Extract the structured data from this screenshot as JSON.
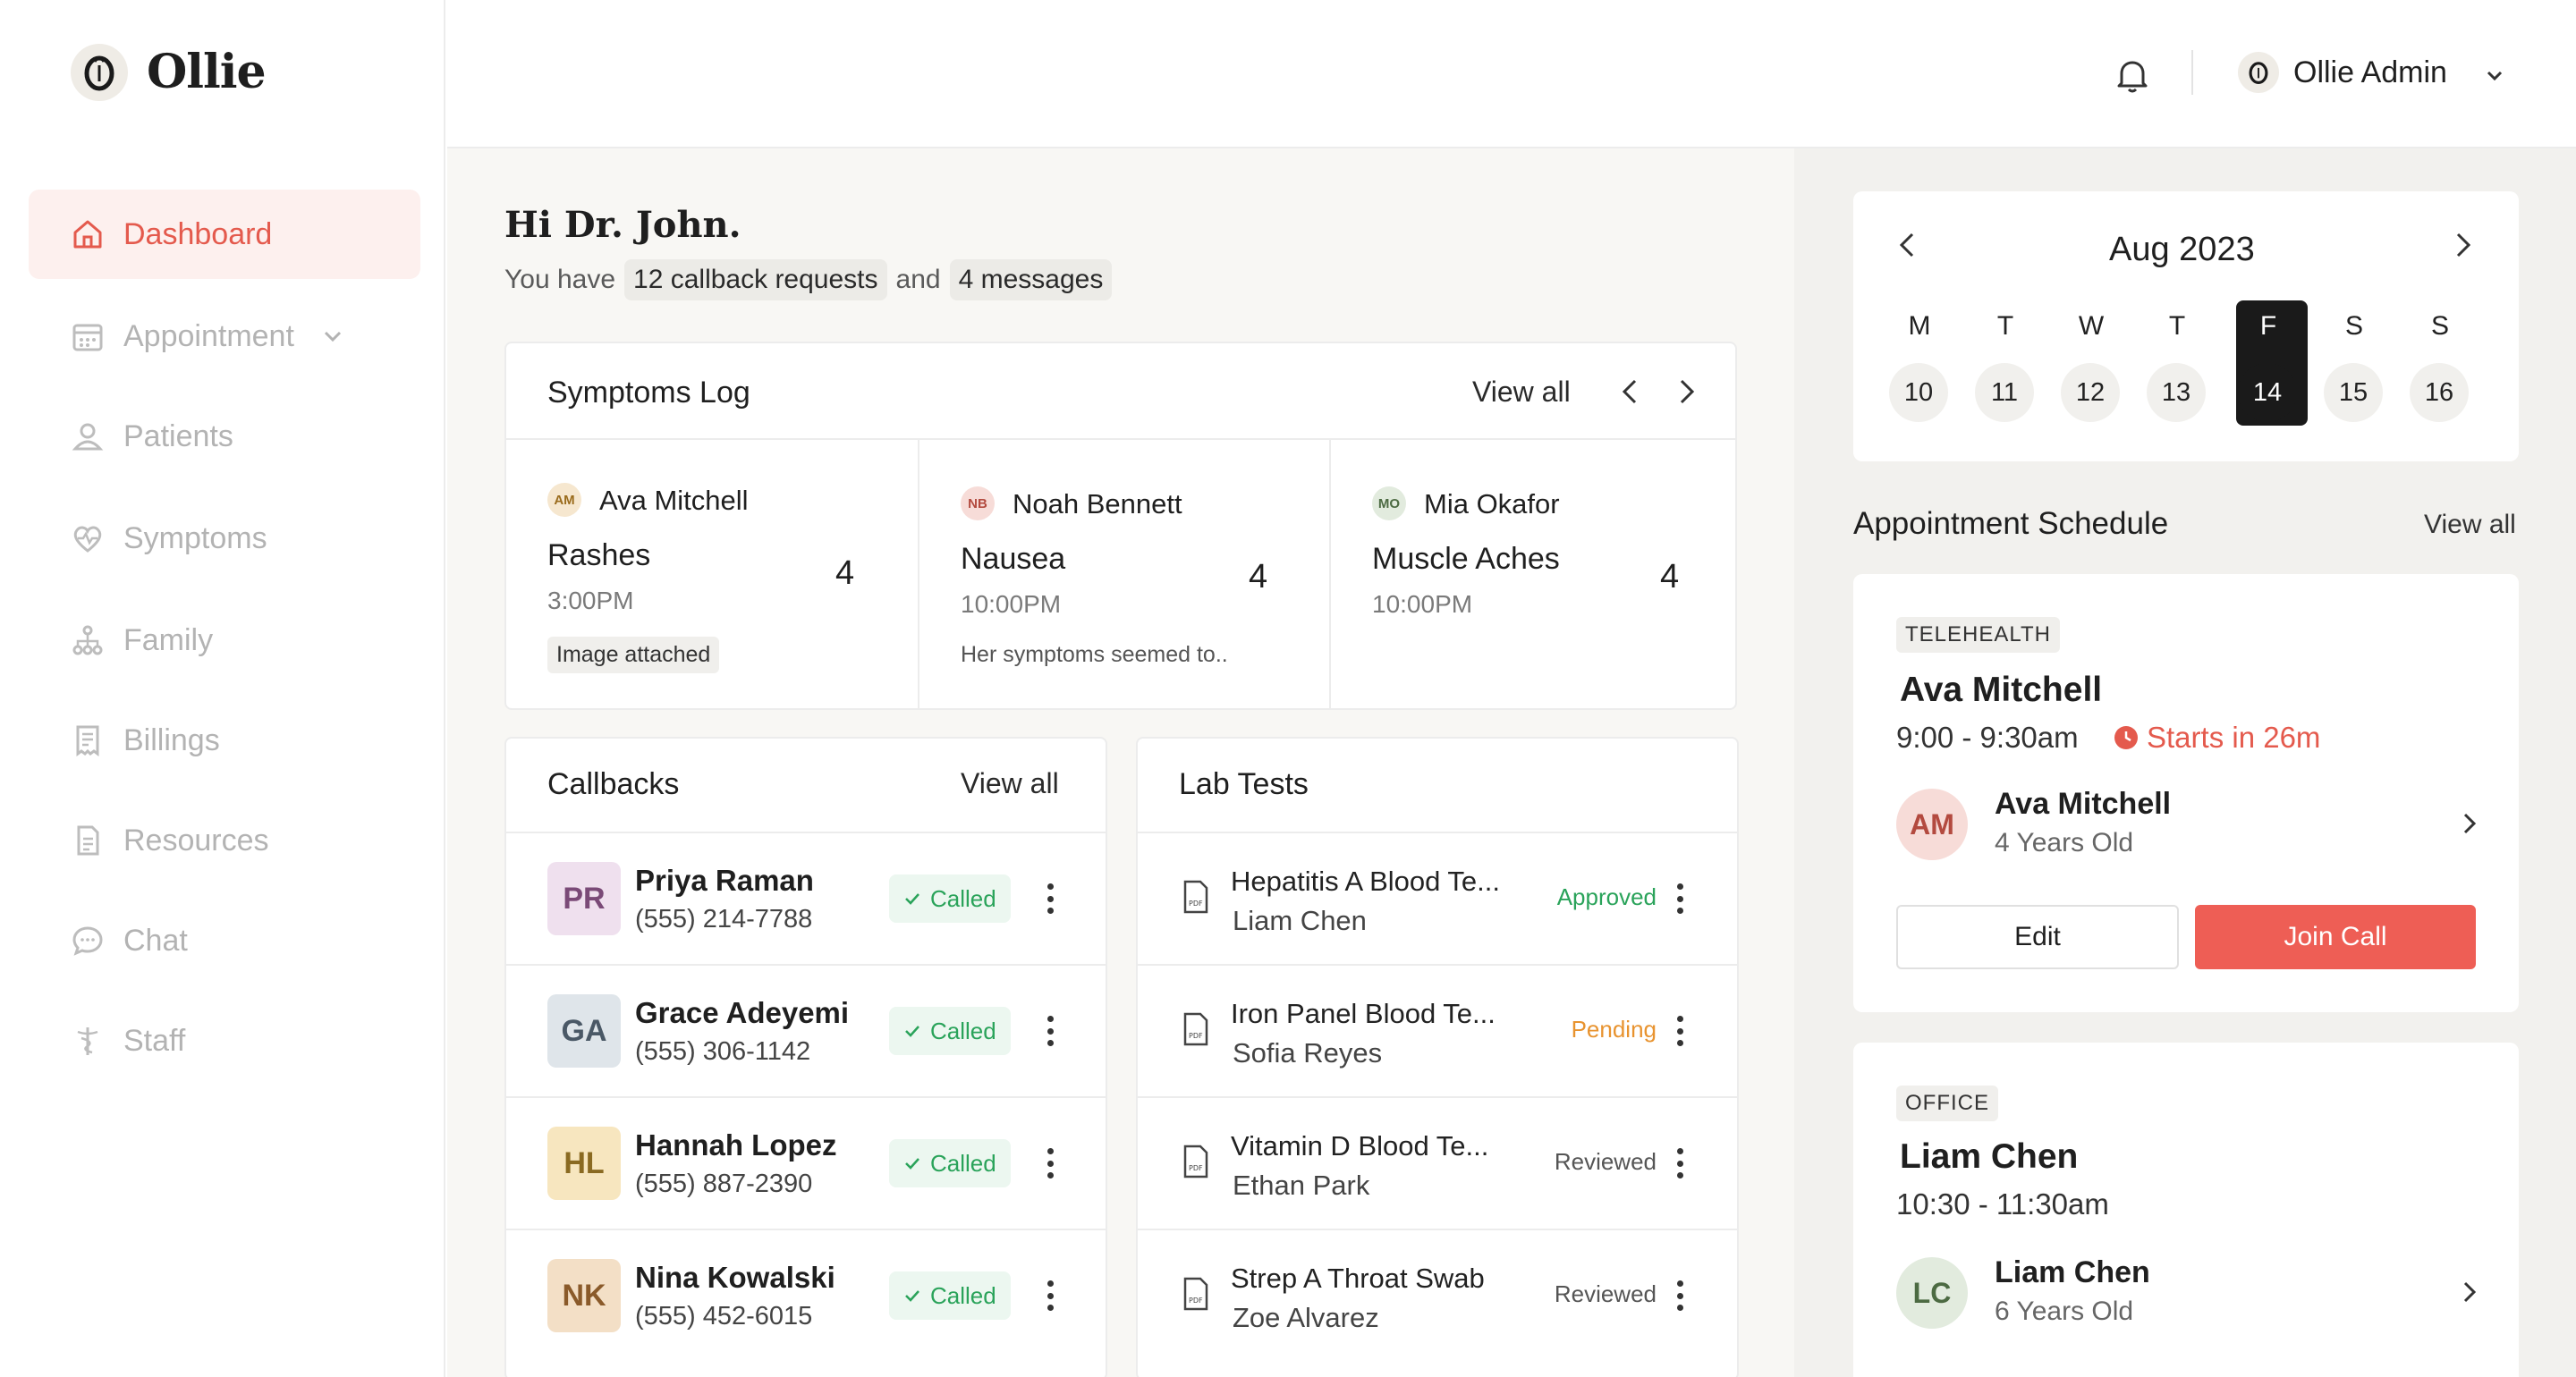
{
  "app": {
    "name": "Ollie"
  },
  "sidebar": {
    "items": [
      {
        "label": "Dashboard",
        "icon": "home-icon",
        "active": true
      },
      {
        "label": "Appointment",
        "icon": "calendar-icon",
        "expandable": true
      },
      {
        "label": "Patients",
        "icon": "patient-icon"
      },
      {
        "label": "Symptoms",
        "icon": "heart-pulse-icon"
      },
      {
        "label": "Family",
        "icon": "family-tree-icon"
      },
      {
        "label": "Billings",
        "icon": "receipt-icon"
      },
      {
        "label": "Resources",
        "icon": "document-icon"
      },
      {
        "label": "Chat",
        "icon": "chat-icon"
      },
      {
        "label": "Staff",
        "icon": "caduceus-icon"
      }
    ]
  },
  "header": {
    "user_name": "Ollie Admin"
  },
  "greeting": {
    "title": "Hi Dr. John.",
    "prefix": "You have",
    "callbacks_chip": "12 callback requests",
    "connector": "and",
    "messages_chip": "4 messages"
  },
  "symptoms_log": {
    "title": "Symptoms Log",
    "view_all": "View all",
    "entries": [
      {
        "initials": "AM",
        "name": "Ava Mitchell",
        "symptom": "Rashes",
        "time": "3:00PM",
        "count": "4",
        "tag": "Image attached",
        "note": ""
      },
      {
        "initials": "NB",
        "name": "Noah Bennett",
        "symptom": "Nausea",
        "time": "10:00PM",
        "count": "4",
        "tag": "",
        "note": "Her symptoms seemed to.."
      },
      {
        "initials": "MO",
        "name": "Mia Okafor",
        "symptom": "Muscle Aches",
        "time": "10:00PM",
        "count": "4",
        "tag": "",
        "note": ""
      }
    ]
  },
  "callbacks": {
    "title": "Callbacks",
    "view_all": "View all",
    "rows": [
      {
        "initials": "PR",
        "name": "Priya Raman",
        "phone": "(555) 214-7788",
        "status": "Called",
        "color": "#efe0ee",
        "text_color": "#7a4a77"
      },
      {
        "initials": "GA",
        "name": "Grace Adeyemi",
        "phone": "(555) 306-1142",
        "status": "Called",
        "color": "#dfe5ea",
        "text_color": "#4a5866"
      },
      {
        "initials": "HL",
        "name": "Hannah Lopez",
        "phone": "(555) 887-2390",
        "status": "Called",
        "color": "#f7e6bf",
        "text_color": "#8a6a22"
      },
      {
        "initials": "NK",
        "name": "Nina Kowalski",
        "phone": "(555) 452-6015",
        "status": "Called",
        "color": "#f3dfc6",
        "text_color": "#8a5a2a"
      }
    ]
  },
  "lab_tests": {
    "title": "Lab Tests",
    "rows": [
      {
        "test": "Hepatitis A Blood Te...",
        "person": "Liam Chen",
        "status": "Approved",
        "status_color": "#2aa35a"
      },
      {
        "test": "Iron Panel Blood Te...",
        "person": "Sofia Reyes",
        "status": "Pending",
        "status_color": "#e8932f"
      },
      {
        "test": "Vitamin D Blood Te...",
        "person": "Ethan Park",
        "status": "Reviewed",
        "status_color": "#555555"
      },
      {
        "test": "Strep A Throat Swab",
        "person": "Zoe Alvarez",
        "status": "Reviewed",
        "status_color": "#555555"
      }
    ]
  },
  "calendar": {
    "month": "Aug 2023",
    "weekdays": [
      "M",
      "T",
      "W",
      "T",
      "F",
      "S",
      "S"
    ],
    "days": [
      "10",
      "11",
      "12",
      "13",
      "14",
      "15",
      "16"
    ],
    "selected_index": 4
  },
  "schedule": {
    "title": "Appointment Schedule",
    "view_all": "View all",
    "appointments": [
      {
        "type": "TELEHEALTH",
        "name": "Ava Mitchell",
        "time": "9:00 - 9:30am",
        "starts": "Starts in 26m",
        "initials": "AM",
        "patient": "Ava Mitchell",
        "age": "4 Years Old",
        "edit": "Edit",
        "join": "Join Call"
      },
      {
        "type": "OFFICE",
        "name": "Liam Chen",
        "time": "10:30 - 11:30am",
        "starts": "",
        "initials": "LC",
        "patient": "Liam Chen",
        "age": "6 Years Old"
      }
    ]
  },
  "colors": {
    "accent": "#e45a4d",
    "button": "#ee5e55",
    "success": "#2aa35a",
    "warning": "#e8932f"
  }
}
